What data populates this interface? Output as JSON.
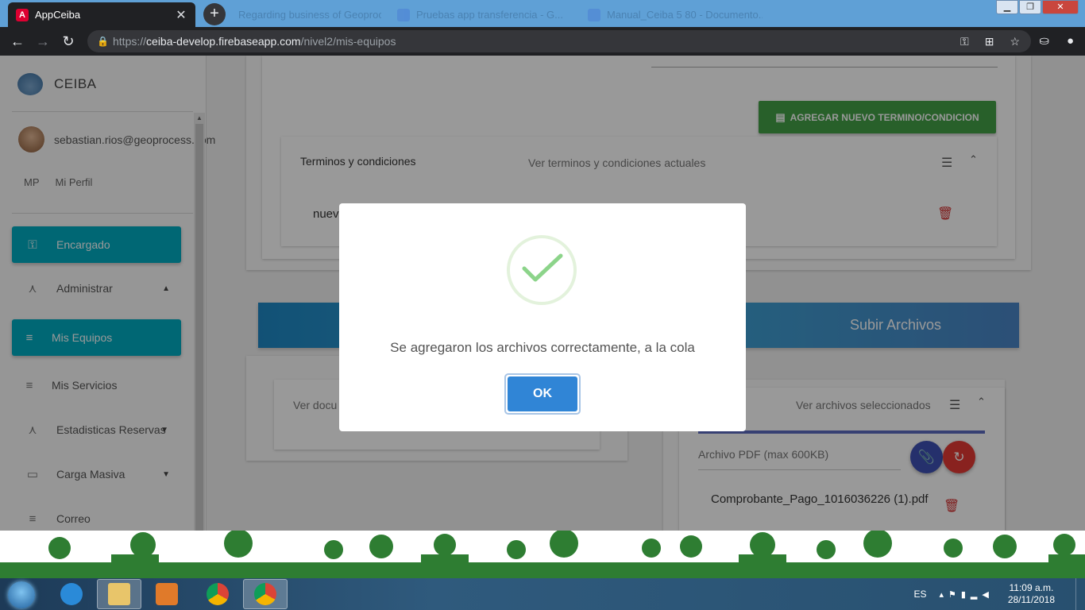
{
  "browser": {
    "active_tab": {
      "title": "AppCeiba",
      "icon": "angular-icon",
      "color": "#dd0031"
    },
    "background_tabs": [
      {
        "title": "Regarding business of Geoprocess ...",
        "icon": "page-icon"
      },
      {
        "title": "Pruebas app transferencia - G...",
        "icon": "docs-icon"
      },
      {
        "title": "Manual_Ceiba 5 80 - Documento...",
        "icon": "docs-icon"
      }
    ],
    "url": {
      "scheme": "https://",
      "host": "ceiba-develop.firebaseapp.com",
      "path": "/nivel2/mis-equipos"
    }
  },
  "sidebar": {
    "brand": "CEIBA",
    "user_email": "sebastian.rios@geoprocess.com",
    "profile_initials": "MP",
    "profile_label": "Mi Perfil",
    "items": [
      {
        "label": "Encargado",
        "icon": "key-icon",
        "active": true
      },
      {
        "label": "Administrar",
        "icon": "hierarchy-icon",
        "caret": "▲"
      },
      {
        "label": "Mis Equipos",
        "icon": "list-icon",
        "active": true
      },
      {
        "label": "Mis Servicios",
        "icon": "list-icon"
      },
      {
        "label": "Estadisticas Reservas",
        "icon": "hierarchy-icon",
        "caret": "▼"
      },
      {
        "label": "Carga Masiva",
        "icon": "clipboard-icon",
        "caret": "▼"
      },
      {
        "label": "Correo",
        "icon": "list-icon"
      }
    ]
  },
  "main": {
    "add_term_button": "AGREGAR NUEVO TERMINO/CONDICION",
    "terms_panel": {
      "title": "Terminos y condiciones",
      "description": "Ver terminos y condiciones actuales",
      "item": "nuevo"
    },
    "upload_banner": "Subir Archivos",
    "docs_panel_title": "Ver docu",
    "files_panel": {
      "description": "Ver archivos seleccionados",
      "file_label": "Archivo PDF (max 600KB)",
      "file_name": "Comprobante_Pago_1016036226 (1).pdf"
    }
  },
  "dialog": {
    "message": "Se agregaron los archivos correctamente, a la cola",
    "ok_label": "OK",
    "success_color": "#8cd48a"
  },
  "taskbar": {
    "language": "ES",
    "time": "11:09 a.m.",
    "date": "28/11/2018",
    "apps": [
      "explorer",
      "internet-explorer",
      "file-manager",
      "media-player",
      "chrome",
      "chrome-active"
    ]
  }
}
